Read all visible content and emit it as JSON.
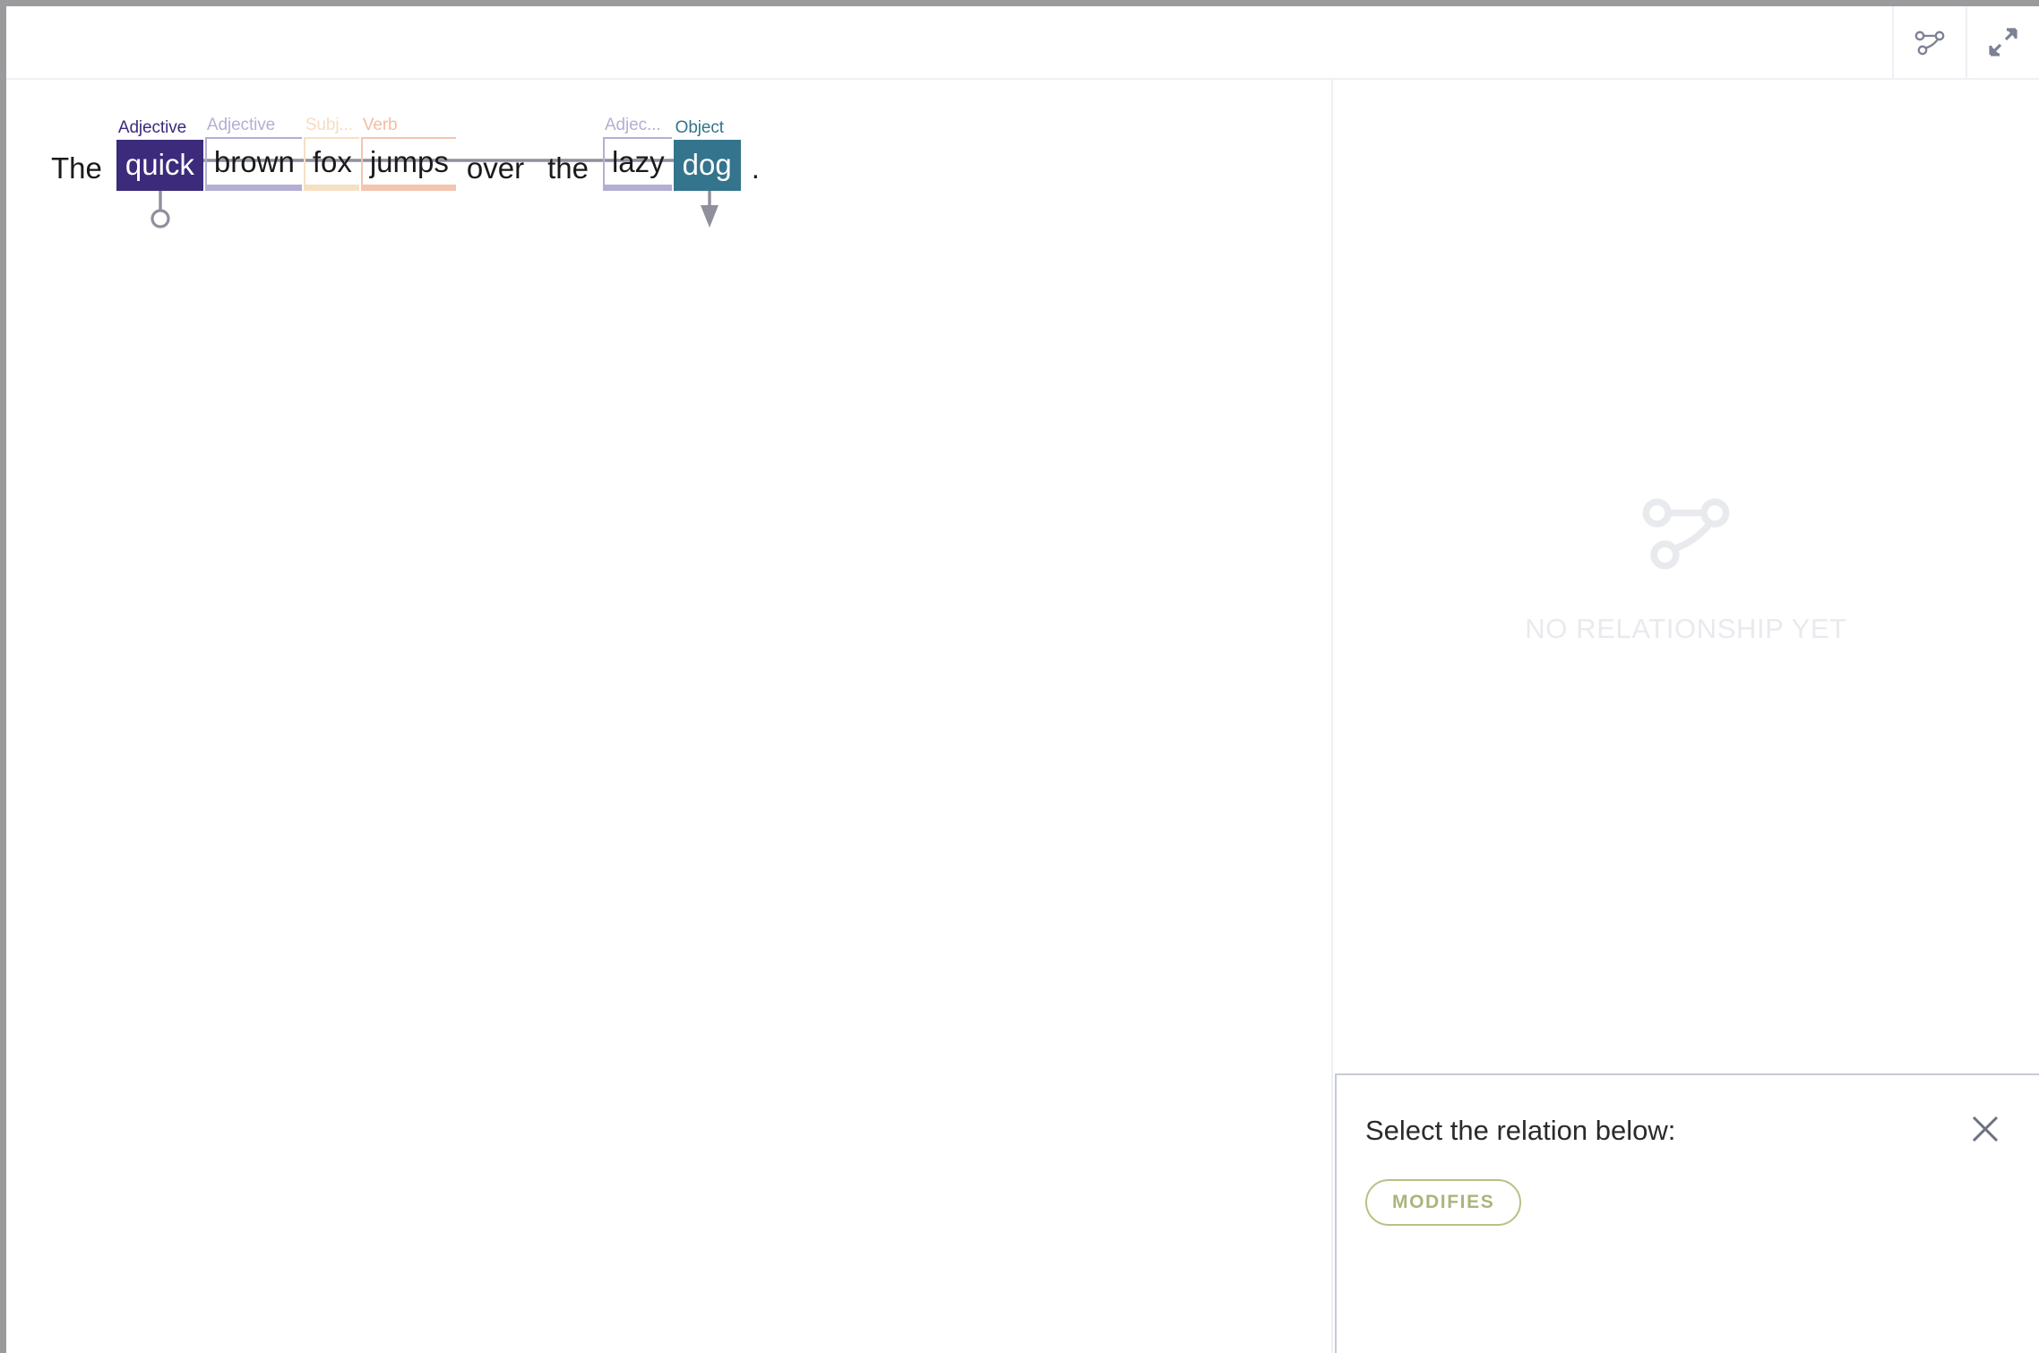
{
  "toolbar": {
    "relation_tool": {
      "name": "relation-graph-icon",
      "title": "Relations"
    },
    "expand_tool": {
      "name": "expand-icon",
      "title": "Expand"
    }
  },
  "document": {
    "sentence_text": "The quick brown fox jumps over the lazy dog .",
    "tokens": [
      {
        "text": "The",
        "label": "",
        "style": "plain",
        "color": ""
      },
      {
        "text": "quick",
        "label": "Adjective",
        "style": "filled",
        "color": "#3c2a7a"
      },
      {
        "text": "brown",
        "label": "Adjective",
        "style": "chip",
        "color": "#b3afd4"
      },
      {
        "text": "fox",
        "label": "Subj...",
        "style": "chip",
        "color": "#f6e0c4"
      },
      {
        "text": "jumps",
        "label": "Verb",
        "style": "chip",
        "color": "#f2c5b0"
      },
      {
        "text": "over",
        "label": "",
        "style": "plain",
        "color": ""
      },
      {
        "text": "the",
        "label": "",
        "style": "plain",
        "color": ""
      },
      {
        "text": "lazy",
        "label": "Adjec...",
        "style": "chip",
        "color": "#b3afd4"
      },
      {
        "text": "dog",
        "label": "Object",
        "style": "filled",
        "color": "#34748c"
      },
      {
        "text": ".",
        "label": "",
        "style": "plain",
        "color": ""
      }
    ],
    "relation_arc": {
      "name": "relation-arc",
      "from_token": "quick",
      "to_token": "dog",
      "stroke": "#8e909c"
    }
  },
  "side_panel": {
    "empty_state": {
      "icon": "relation-graph-icon",
      "message": "NO RELATIONSHIP YET",
      "color": "#e8eaee"
    },
    "dialog": {
      "title": "Select the relation below:",
      "close_label": "×",
      "relations": [
        {
          "label": "MODIFIES",
          "color": "#aab57c",
          "border": "#b7c186"
        }
      ]
    }
  },
  "colors": {
    "selected_adjective": "#3c2a7a",
    "adjective": "#b3afd4",
    "subject": "#f6e0c4",
    "verb": "#f2c5b0",
    "object": "#34748c",
    "arc": "#8e909c",
    "divider": "#eef0f4",
    "frame": "#9b9b9d",
    "relation_green": "#aab57c"
  }
}
